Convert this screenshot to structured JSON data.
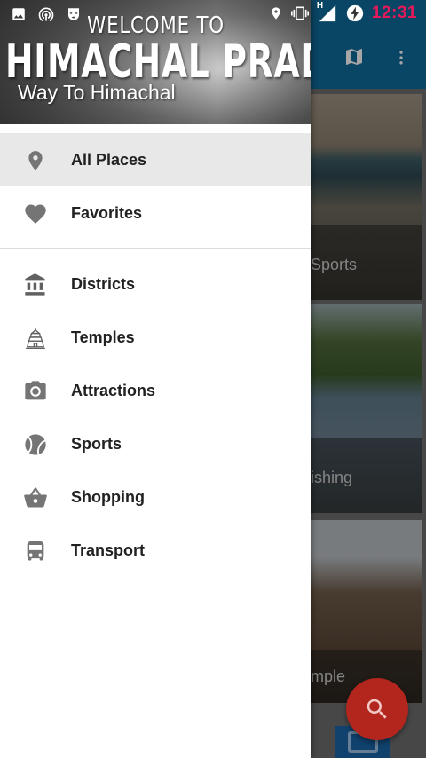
{
  "status_bar": {
    "time": "12:31",
    "network_type": "H",
    "icons": [
      "image-icon",
      "hotspot-icon",
      "incognito-icon",
      "location-icon",
      "vibrate-icon",
      "signal-icon",
      "battery-charging-icon"
    ]
  },
  "drawer": {
    "header": {
      "welcome": "WELCOME TO",
      "title": "HIMACHAL PRADESH",
      "subtitle": "Way To Himachal"
    },
    "primary_items": [
      {
        "label": "All Places",
        "icon": "location-icon",
        "active": true
      },
      {
        "label": "Favorites",
        "icon": "heart-icon",
        "active": false
      }
    ],
    "category_items": [
      {
        "label": "Districts",
        "icon": "bank-icon"
      },
      {
        "label": "Temples",
        "icon": "temple-icon"
      },
      {
        "label": "Attractions",
        "icon": "camera-icon"
      },
      {
        "label": "Sports",
        "icon": "tennis-ball-icon"
      },
      {
        "label": "Shopping",
        "icon": "basket-icon"
      },
      {
        "label": "Transport",
        "icon": "bus-icon"
      }
    ]
  },
  "background": {
    "toolbar_icons": [
      "map-icon",
      "more-vert-icon"
    ],
    "cards": [
      {
        "caption": "Sports"
      },
      {
        "caption": "ishing"
      },
      {
        "caption": "mple"
      }
    ],
    "fab_icon": "search-icon"
  },
  "colors": {
    "status_time": "#e8195a",
    "toolbar": "#0f6a9a",
    "fab": "#b3261e",
    "active_item_bg": "#e8e8e8",
    "icon_gray": "#757575"
  }
}
